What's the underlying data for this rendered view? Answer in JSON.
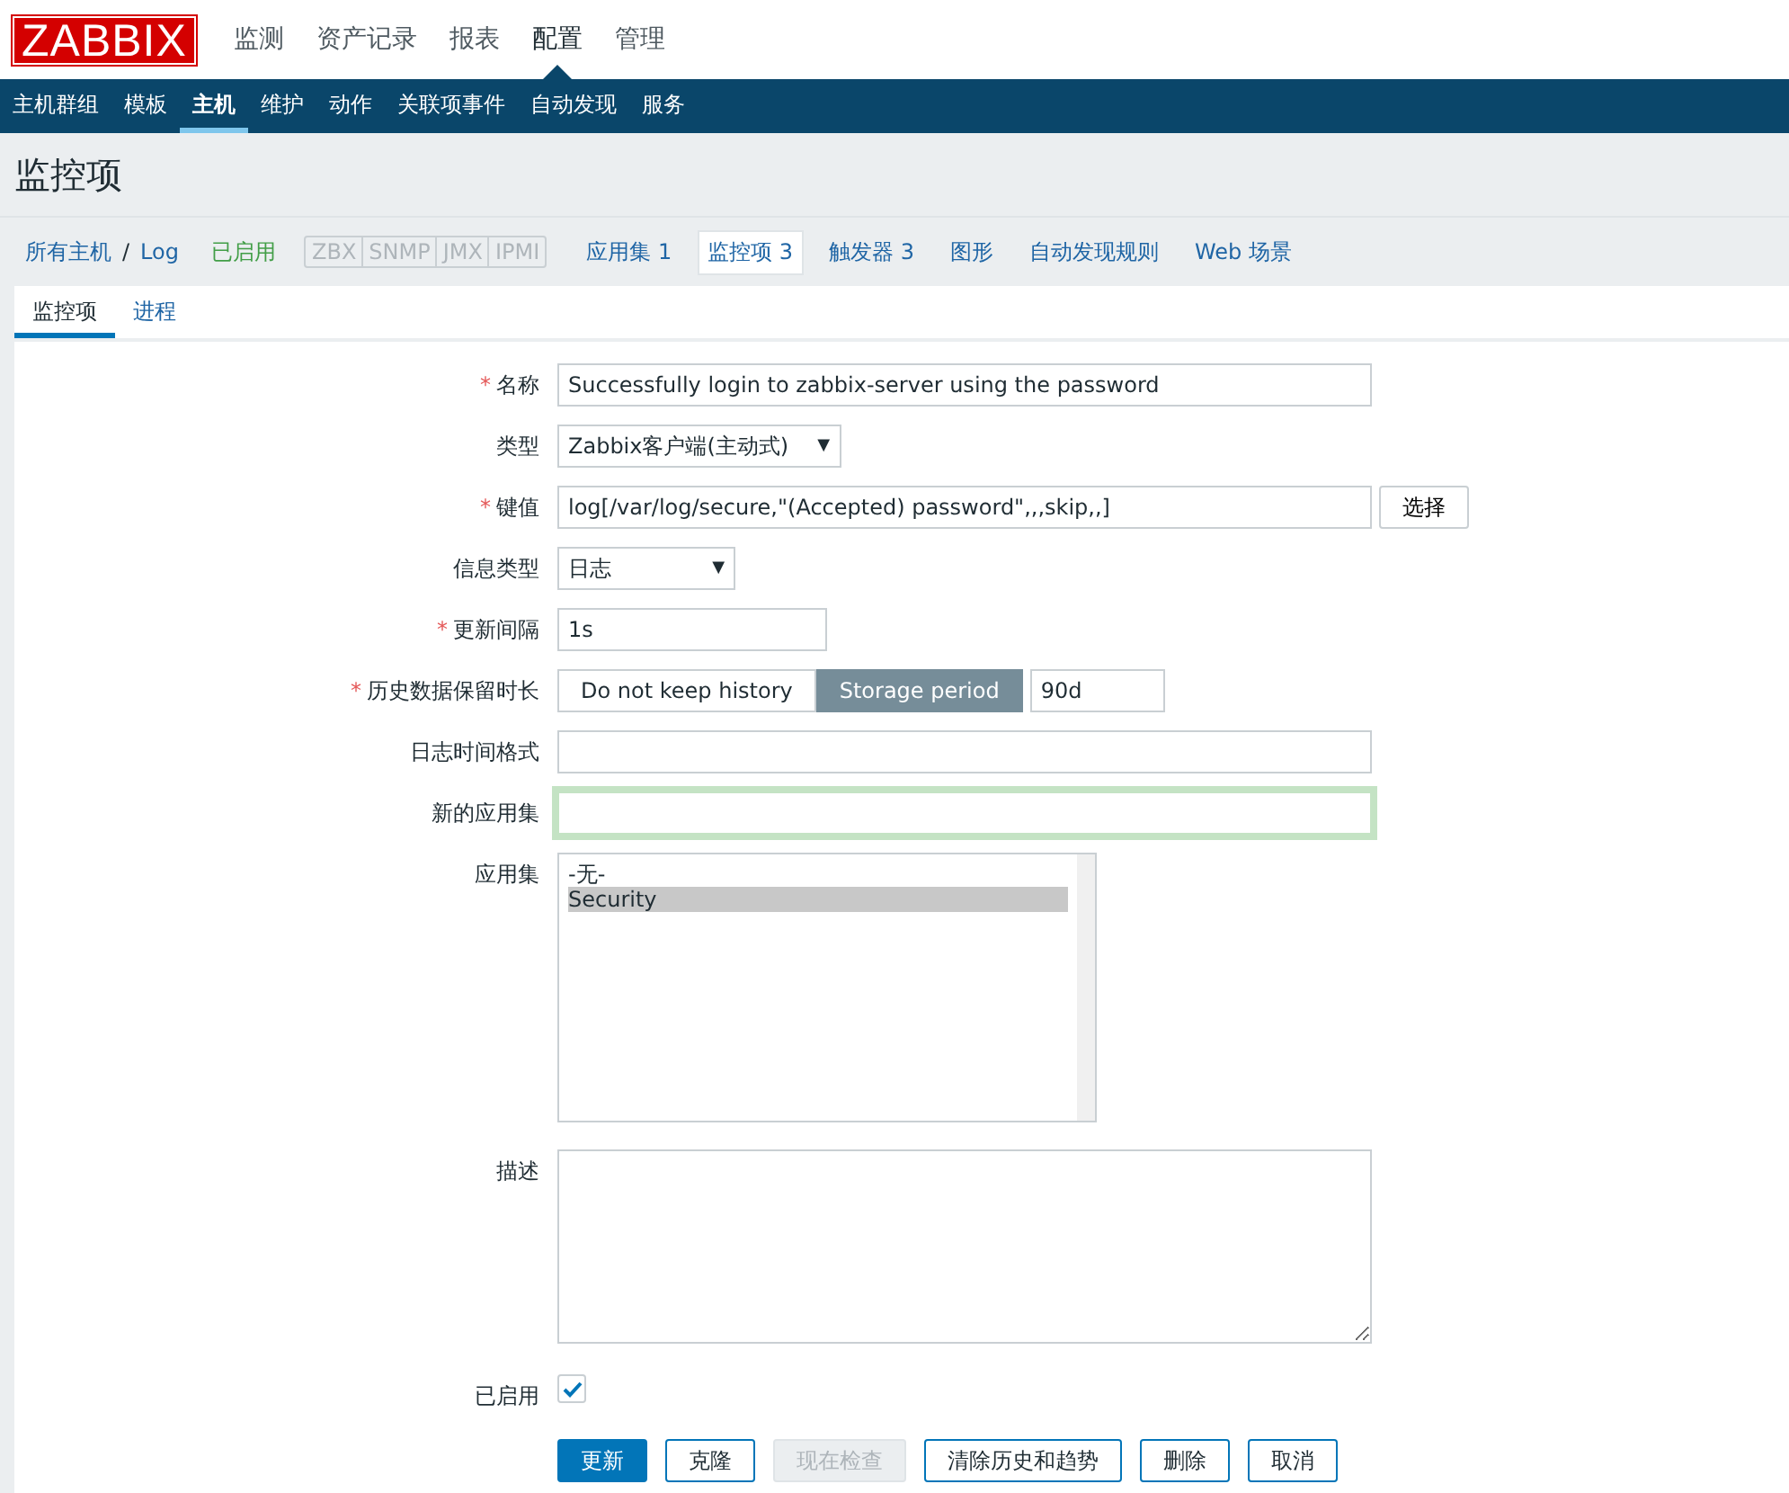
{
  "logo": "ZABBIX",
  "main_menu": [
    {
      "label": "监测",
      "selected": false
    },
    {
      "label": "资产记录",
      "selected": false
    },
    {
      "label": "报表",
      "selected": false
    },
    {
      "label": "配置",
      "selected": true
    },
    {
      "label": "管理",
      "selected": false
    }
  ],
  "sub_menu": [
    {
      "label": "主机群组",
      "selected": false
    },
    {
      "label": "模板",
      "selected": false
    },
    {
      "label": "主机",
      "selected": true
    },
    {
      "label": "维护",
      "selected": false
    },
    {
      "label": "动作",
      "selected": false
    },
    {
      "label": "关联项事件",
      "selected": false
    },
    {
      "label": "自动发现",
      "selected": false
    },
    {
      "label": "服务",
      "selected": false
    }
  ],
  "page_title": "监控项",
  "breadcrumbs": {
    "all_hosts": "所有主机",
    "separator": "/",
    "host": "Log",
    "status": "已启用",
    "availability": [
      "ZBX",
      "SNMP",
      "JMX",
      "IPMI"
    ],
    "links": [
      {
        "label": "应用集",
        "count": "1",
        "selected": false
      },
      {
        "label": "监控项",
        "count": "3",
        "selected": true
      },
      {
        "label": "触发器",
        "count": "3",
        "selected": false
      },
      {
        "label": "图形",
        "selected": false
      },
      {
        "label": "自动发现规则",
        "selected": false
      },
      {
        "label": "Web 场景",
        "selected": false
      }
    ]
  },
  "tabs": [
    {
      "label": "监控项",
      "selected": true
    },
    {
      "label": "进程",
      "selected": false
    }
  ],
  "form": [
    {
      "kind": "text",
      "label": "名称",
      "required_mark": "*",
      "value": "Successfully login to zabbix-server using the password"
    },
    {
      "kind": "select",
      "label": "类型",
      "value": "Zabbix客户端(主动式)",
      "arrow": "▼"
    },
    {
      "kind": "key",
      "label": "键值",
      "required_mark": "*",
      "value": "log[/var/log/secure,\"(Accepted) password\",,,skip,,]",
      "button": "选择"
    },
    {
      "kind": "select",
      "label": "信息类型",
      "value": "日志",
      "arrow": "▼"
    },
    {
      "kind": "short",
      "label": "更新间隔",
      "required_mark": "*",
      "value": "1s"
    },
    {
      "kind": "history",
      "label": "历史数据保留时长",
      "required_mark": "*",
      "options": [
        {
          "label": "Do not keep history",
          "selected": false
        },
        {
          "label": "Storage period",
          "selected": true
        }
      ],
      "value": "90d"
    },
    {
      "kind": "text",
      "label": "日志时间格式"
    },
    {
      "kind": "text",
      "label": "新的应用集",
      "focused": true
    },
    {
      "kind": "list",
      "label": "应用集",
      "items": [
        {
          "label": "-无-",
          "selected": false
        },
        {
          "label": "Security",
          "selected": true
        }
      ]
    },
    {
      "kind": "textarea",
      "label": "描述"
    },
    {
      "kind": "checkbox",
      "label": "已启用",
      "checked": true
    }
  ],
  "buttons": [
    {
      "label": "更新",
      "kind": "primary"
    },
    {
      "label": "克隆",
      "kind": "normal"
    },
    {
      "label": "现在检查",
      "kind": "disabled"
    },
    {
      "label": "清除历史和趋势",
      "kind": "normal"
    },
    {
      "label": "删除",
      "kind": "normal"
    },
    {
      "label": "取消",
      "kind": "normal"
    }
  ]
}
